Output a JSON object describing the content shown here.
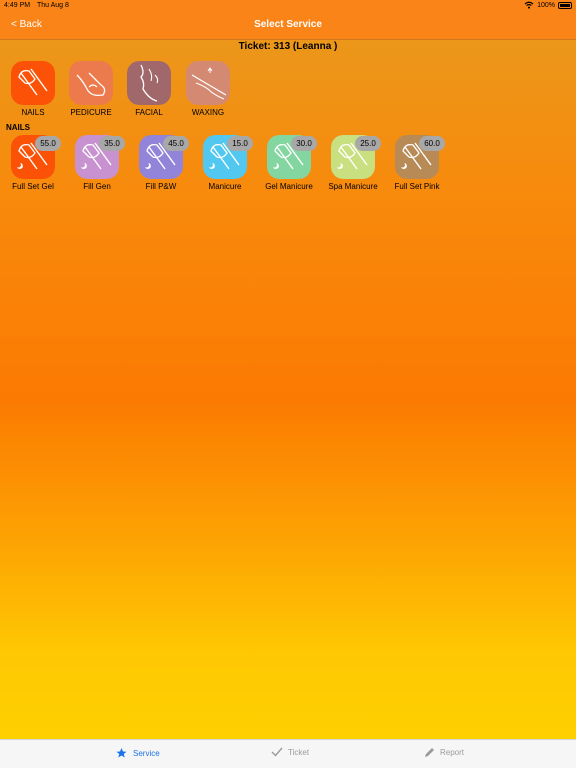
{
  "status": {
    "time": "4:49 PM",
    "date": "Thu Aug 8",
    "battery": "100%"
  },
  "nav": {
    "back_label": "< Back",
    "title": "Select Service"
  },
  "ticket": {
    "label": "Ticket: 313 (Leanna )"
  },
  "categories": [
    {
      "label": "NAILS",
      "color": "#fb5207",
      "icon": "nail-icon"
    },
    {
      "label": "PEDICURE",
      "color": "#ed7a4c",
      "icon": "foot-icon"
    },
    {
      "label": "FACIAL",
      "color": "#a0686a",
      "icon": "face-icon"
    },
    {
      "label": "WAXING",
      "color": "#d48a72",
      "icon": "leg-icon"
    }
  ],
  "section_title": "NAILS",
  "services": [
    {
      "label": "Full Set Gel",
      "price": "55.0",
      "color": "#fb5207"
    },
    {
      "label": "Fill Gen",
      "price": "35.0",
      "color": "#c892d0"
    },
    {
      "label": "Fill P&W",
      "price": "45.0",
      "color": "#9284d8"
    },
    {
      "label": "Manicure",
      "price": "15.0",
      "color": "#52c8f0"
    },
    {
      "label": "Gel Manicure",
      "price": "30.0",
      "color": "#84d6a0"
    },
    {
      "label": "Spa Manicure",
      "price": "25.0",
      "color": "#c8e080"
    },
    {
      "label": "Full Set Pink",
      "price": "60.0",
      "color": "#b88a56"
    }
  ],
  "tabs": [
    {
      "label": "Service",
      "icon": "star-icon",
      "active": true,
      "accent": "#1a73e8"
    },
    {
      "label": "Ticket",
      "icon": "checkmark-icon",
      "active": false
    },
    {
      "label": "Report",
      "icon": "pencil-icon",
      "active": false
    }
  ]
}
